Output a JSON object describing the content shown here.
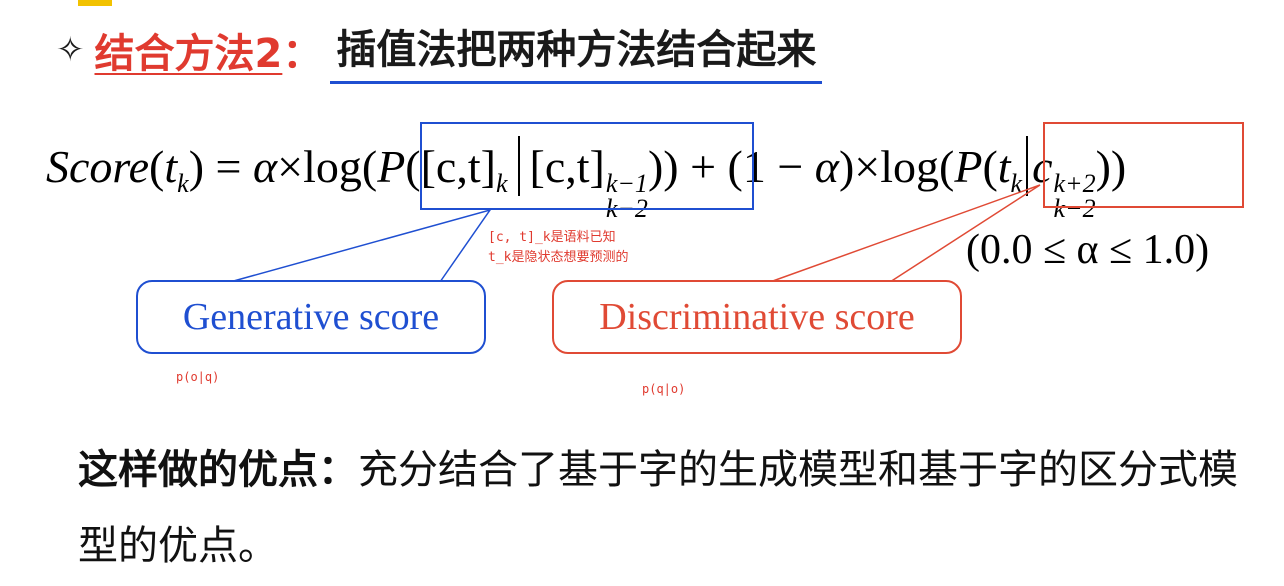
{
  "title": {
    "bullet": "✧",
    "red_part": "结合方法2",
    "colon": "：",
    "rest": "插值法把两种方法结合起来"
  },
  "formula": {
    "lhs": "Score",
    "t": "t",
    "k": "k",
    "eq": " = ",
    "alpha": "α",
    "times": "×",
    "log": "log",
    "P": "P",
    "ct": "([c,t]",
    "ct2": "[c,t]",
    "sup_a": "k−1",
    "sub_a": "k−2",
    "close": "))",
    "plus": " + (1 − ",
    "close2": ")",
    "c": "c",
    "sup_b": "k+2",
    "sub_b": "k−2"
  },
  "note": {
    "line1": "[c, t]_k是语料已知",
    "line2": "t_k是隐状态想要预测的"
  },
  "alpha_range": "(0.0 ≤ α ≤ 1.0)",
  "callouts": {
    "generative": "Generative score",
    "discriminative": "Discriminative score"
  },
  "small_labels": {
    "p_o_given_q": "p(o|q)",
    "p_q_given_o": "p(q|o)"
  },
  "advantage": {
    "bold": "这样做的优点：",
    "text": "充分结合了基于字的生成模型和基于字的区分式模型的优点。"
  },
  "colors": {
    "red": "#e03a2f",
    "blue": "#1f4fd1",
    "accent_strip": "#f2c200"
  }
}
